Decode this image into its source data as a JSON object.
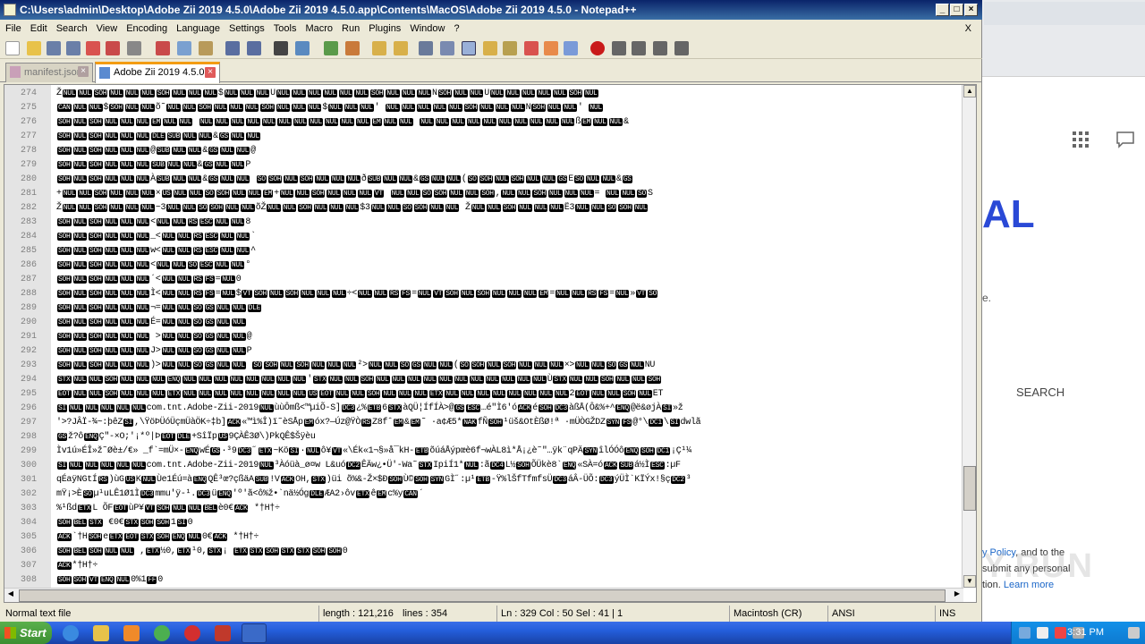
{
  "window": {
    "title": "C:\\Users\\admin\\Desktop\\Adobe Zii 2019 4.5.0\\Adobe Zii 2019 4.5.0.app\\Contents\\MacOS\\Adobe Zii 2019 4.5.0 - Notepad++"
  },
  "menu": [
    "File",
    "Edit",
    "Search",
    "View",
    "Encoding",
    "Language",
    "Settings",
    "Tools",
    "Macro",
    "Run",
    "Plugins",
    "Window",
    "?"
  ],
  "menu_close": "X",
  "tabs": [
    {
      "label": "manifest.json",
      "active": false
    },
    {
      "label": "Adobe Zii 2019 4.5.0",
      "active": true
    }
  ],
  "editor": {
    "lines": [
      {
        "n": "274",
        "text": "ŽNULNULSOHNULNULNULSOHNULNULNUL$NULNULNULUNULNULNULNULNULNULSOHNULNULNULNSOHNULNULUNULNULNULNULNULSOHNUL"
      },
      {
        "n": "275",
        "text": "CANNULNUL$SOHNULNULõ˜NULNULSOHNULNULNULSOHNULNULNUL$NULNULNUL' NULNULNULNULNULSOHNULNULNULNSOHNULNUL' NUL"
      },
      {
        "n": "276",
        "text": "SOHNULSOHNULNULNULEMNULNUL NULNULNULNULNULNULNULNULNULNULNULEMNULNUL NULNULNULNULNULNULNULNULNULNULßEMNULNUL&"
      },
      {
        "n": "277",
        "text": "SOHNULSOHNULNULNULDLESUBNULNUL&GSNULNUL"
      },
      {
        "n": "278",
        "text": "SOHNULSOHNULNULNUL@SUBNULNUL&GSNULNUL@"
      },
      {
        "n": "279",
        "text": "SOHNULSOHNULNULNULSUBNULNUL&GSNULNULP"
      },
      {
        "n": "280",
        "text": "SOHNULSOHNULNULNULÀSUBNULNUL&GSNULNUL SOSOHNULSOHNULNULNULðSUBNULNUL&GSNULNUL(SOSOHNULSOHNULNULGSESONULNUL&GS"
      },
      {
        "n": "281",
        "text": "+NULNULSOHNULNULNUL×USNULNULSOSOHNULNULEM+NULNULSOHNULNULNULVT NULNULSOSOHNULNULSOH,NULNULSOHNULNULNUL= NULNULSOS"
      },
      {
        "n": "282",
        "text": "ŽNULNULSOHNULNULNUL~3NULNULSOSOHNULNULõŽNULNULSOHNULNULNUL$3NULNULSOSOHNULNUL ŽNULNULSOHNULNULNULË3NULNULSOSOHNUL"
      },
      {
        "n": "283",
        "text": "SOHNULSOHNULNULNUL<NULNULRSESCNULNUL8"
      },
      {
        "n": "284",
        "text": "SOHNULSOHNULNULNUL_<NULNULRSESCNULNUL`"
      },
      {
        "n": "285",
        "text": "SOHNULSOHNULNULNULw<NULNULRSESCNULNUL^"
      },
      {
        "n": "286",
        "text": "SOHNULSOHNULNULNUL<NULNULSOESCNULNUL°"
      },
      {
        "n": "287",
        "text": "SOHNULSOHNULNULNUL´<NULNULRSFS=NUL0"
      },
      {
        "n": "288",
        "text": "SOHNULSOHNULNULNULÌ<NULNULRSFS=NUL$VTSOHNULSOHNULNULNUL÷<NULNULRSFS=NULVTSOHNULSOHNULNULNULEM=NULNULRSFS=NUL»VTSO"
      },
      {
        "n": "289",
        "text": "SOHNULSOHNULNULNUL¬=NULNULSOGSNULNULDLE"
      },
      {
        "n": "290",
        "text": "SOHNULSOHNULNULNULÉ=NULNULSOGSNULNUL"
      },
      {
        "n": "291",
        "text": "SOHNULSOHNULNULNUL >NULNULSOGSNULNUL@"
      },
      {
        "n": "292",
        "text": "SOHNULSOHNULNULNULJ>NULNULSOGSNULNULP"
      },
      {
        "n": "293",
        "text": "SOHNULSOHNULNULNUL)>NULNULSOGSNULNUL SOSOHNULSOHNULNULNUL²>NULNULSOGSNULNUL(SOSOHNULSOHNULNULNUL×>NULNULSOGSNULNU"
      },
      {
        "n": "294",
        "text": "STXNULNULSOHNULNULNULENQNULNULNULNULNULNULNULNUL'STXNULNULSOHNULNULNULNULNULNULNULNULNULNULNULÙSTXNULNULSOHNULNULSOH"
      },
      {
        "n": "295",
        "text": "EOTNULNULSOHNULNULNULETXNULNULNULNULNULNULNULNULUSEOTNULNULSOHNULNULNULETXNULNULNULNULNULNULNULNUL2EOTNULNULSOHNULET"
      },
      {
        "n": "296",
        "text": "SINULNULNULNULNULcom.tnt.Adobe-Zii-2019NULùùÔmß<™µiÕ-S]DC3¿%ETB6STXàQÜ¦ÍfÍÀ>@GSESC…é\"Ì6'óACKéSOHDC3àßÅ(Ô&%+^ENQ@ë&øjÀSI»ž"
      },
      {
        "n": "297",
        "text": "'>?JÂÏ-¾~:þêZSI,\\ŸöÞÜóÜçmÜàÖK÷‡b]ACK«™ì%Î)ï˜èSÅpEMóx?—Úz@ŸÒRSZ8fˆEM&EM˜ ·a¢Æ5*NAKfÑSOH¹üš&OtÈßØ!ª ·mÜÒGŽDZSYNFS@°\\DC1\\SIdwlã"
      },
      {
        "n": "298",
        "text": "GSž?ôENQÇ\"-×O;'¡*º|ÞEOTDLE+SîÏpUS9ÇÀÊ3Ø\\)PkQÊ$Šÿèu"
      },
      {
        "n": "299",
        "text": "Ìv1ú»ÉÎ»ž˜Øè±/€» _f`=mÜ×-ENQwÉGS·³9DC3˝ETX~KöSI·NULô¥VT«\\Ék«1¬§»å¯kH-ETBõúáÅýpœè6f¬wÀL8ì*Å¡¿è˜\"…ÿk¨qPÄSYNîlÓÓôENQSOHDC1¡Ç¹¼"
      },
      {
        "n": "300",
        "text": "SINULNULNULNULNULcom.tnt.Adobe-Zii-2019NUL³Àóüà_ø¤w L&uóDC2ÊÄw¿•Ü'-Wa˜STXIpiÍ1*NUL:ãDC4L½SOHÕÜkè8`ENQ«SÀ=óACKSUBá½ÌESC:µF"
      },
      {
        "n": "301",
        "text": "qÉaÿNGtÍRS)ùGUSKNULÙe1Éú=àENQQÊ³œ?çßäASUB!VACKOH,STX)üi õ%&-Ž×$ÐSOHÙ©SOHSYNGÌ˝:µ¹ETB-Ÿ%lŠfTfmfsÜDC3áÂ-ÜÕ:DC3ýÜÌ`KÏÝx!§çDC2³"
      },
      {
        "n": "302",
        "text": "mŸ¡>ÈSOµ¹uLÊ1Ø1ÌDC3mmu'ÿ-¹.DC3üENQ'º'ã<ô%ž•`nä½ÓgDLEÆA2›ôvETXêEMc%yCAN´"
      },
      {
        "n": "303",
        "text": "%¹ßdETXL ÕFEOTùP¥VTSOHNULNULBELè0€ACK *†H†÷"
      },
      {
        "n": "304",
        "text": "SOHBELSTX €0€STXSOHSOH1SI0"
      },
      {
        "n": "305",
        "text": "ACK`†HSOHeETXEOTSTXSOHENQNUL0€ACK *†H†÷"
      },
      {
        "n": "306",
        "text": "SOHBELSOHNULNUL ,ETX½0,ETX¹0,STX¡ ETXSTXSOHSTXSTXSOHSOH0"
      },
      {
        "n": "307",
        "text": "ACK*†H†÷"
      },
      {
        "n": "308",
        "text": "SOHSOHVTENQNUL0%1FF0"
      }
    ]
  },
  "status": {
    "type": "Normal text file",
    "length": "length : 121,216",
    "lines": "lines : 354",
    "pos": "Ln : 329    Col : 50    Sel : 41 | 1",
    "eol": "Macintosh (CR)",
    "enc": "ANSI",
    "mode": "INS"
  },
  "background_page": {
    "heading": "AL",
    "frag": "e.",
    "search": "SEARCH",
    "policy_prefix": "",
    "policy_link": "y Policy",
    "policy_text": ", and to the",
    "policy_line2": "submit any personal",
    "policy_line3": "tion. ",
    "learn_more": "Learn more",
    "watermark": "ANY.RUN"
  },
  "taskbar": {
    "start": "Start",
    "clock": "3:31 PM"
  },
  "colors": {
    "titlebar": "#0a246a",
    "control_char_bg": "#000000",
    "accent_blue": "#2a49d6",
    "tab_accent": "#f39c12"
  }
}
